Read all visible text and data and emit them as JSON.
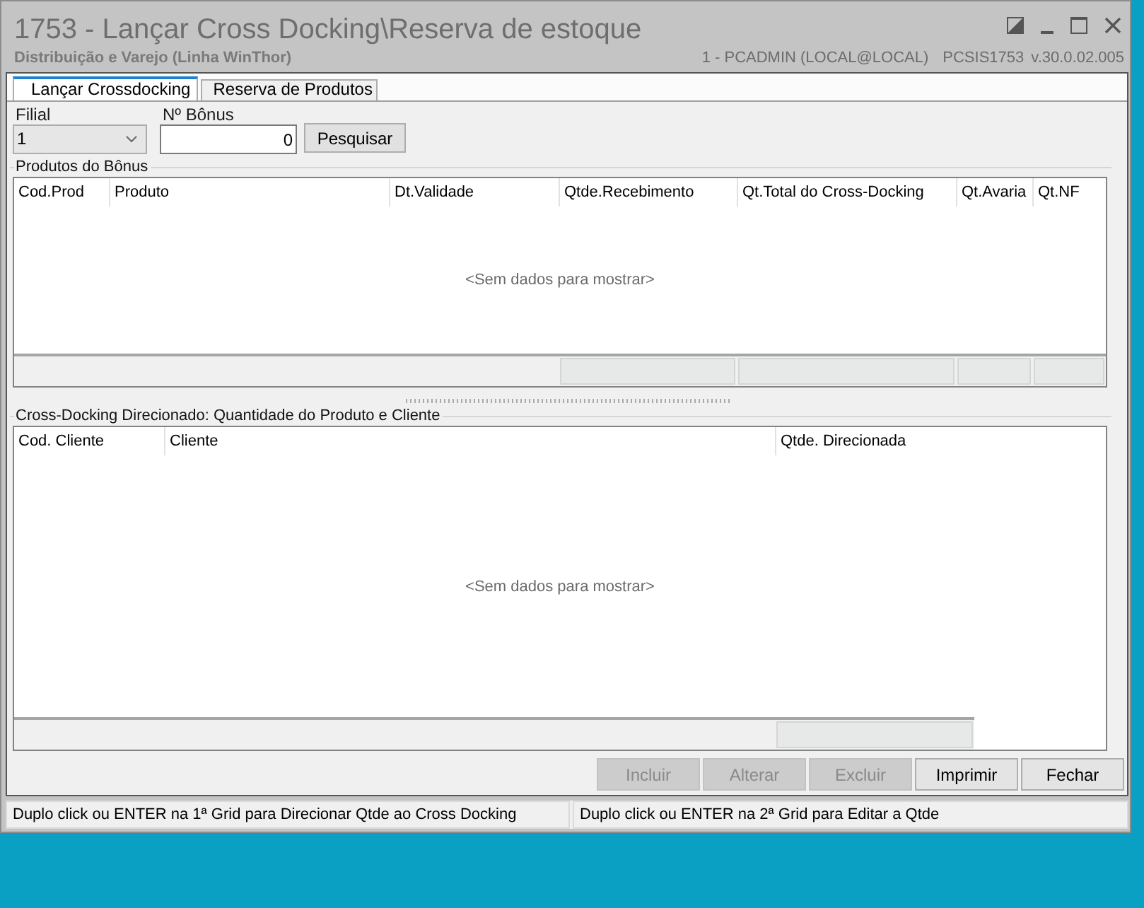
{
  "window": {
    "title": "1753 - Lançar Cross Docking\\Reserva de estoque",
    "subtitle": "Distribuição e Varejo (Linha WinThor)",
    "session": "1 - PCADMIN (LOCAL@LOCAL)",
    "program": "PCSIS1753",
    "version": "v.30.0.02.005",
    "controls": [
      {
        "kind": "dock"
      },
      {
        "kind": "minimize"
      },
      {
        "kind": "maximize"
      },
      {
        "kind": "close"
      }
    ]
  },
  "tabs": [
    {
      "label": "Lançar Crossdocking",
      "selected": true
    },
    {
      "label": "Reserva de Produtos",
      "selected": false
    }
  ],
  "filters": {
    "branch": {
      "label": "Filial",
      "value": "1"
    },
    "bonus": {
      "label": "Nº Bônus",
      "value": "0"
    },
    "search_button": "Pesquisar"
  },
  "products_group": {
    "title": "Produtos do Bônus",
    "columns": [
      {
        "label": "Cod.Prod",
        "summary": false
      },
      {
        "label": "Produto",
        "summary": false
      },
      {
        "label": "Dt.Validade",
        "summary": false
      },
      {
        "label": "Qtde.Recebimento",
        "summary": true
      },
      {
        "label": "Qt.Total do Cross-Docking",
        "summary": true
      },
      {
        "label": "Qt.Avaria",
        "summary": true
      },
      {
        "label": "Qt.NF",
        "summary": true
      }
    ],
    "empty_text": "<Sem dados para mostrar>"
  },
  "directed_group": {
    "title": "Cross-Docking Direcionado: Quantidade do Produto e Cliente",
    "columns": [
      {
        "label": "Cod. Cliente",
        "summary": false
      },
      {
        "label": "Cliente",
        "summary": false
      },
      {
        "label": "Qtde. Direcionada",
        "summary": true
      }
    ],
    "empty_text": "<Sem dados para mostrar>"
  },
  "buttons": [
    {
      "label": "Incluir",
      "disabled": true
    },
    {
      "label": "Alterar",
      "disabled": true
    },
    {
      "label": "Excluir",
      "disabled": true
    },
    {
      "label": "Imprimir",
      "disabled": false
    },
    {
      "label": "Fechar",
      "disabled": false
    }
  ],
  "status_bar": [
    "Duplo click ou ENTER na 1ª Grid para Direcionar Qtde ao Cross Docking",
    "Duplo click ou ENTER na 2ª Grid para Editar a Qtde"
  ]
}
